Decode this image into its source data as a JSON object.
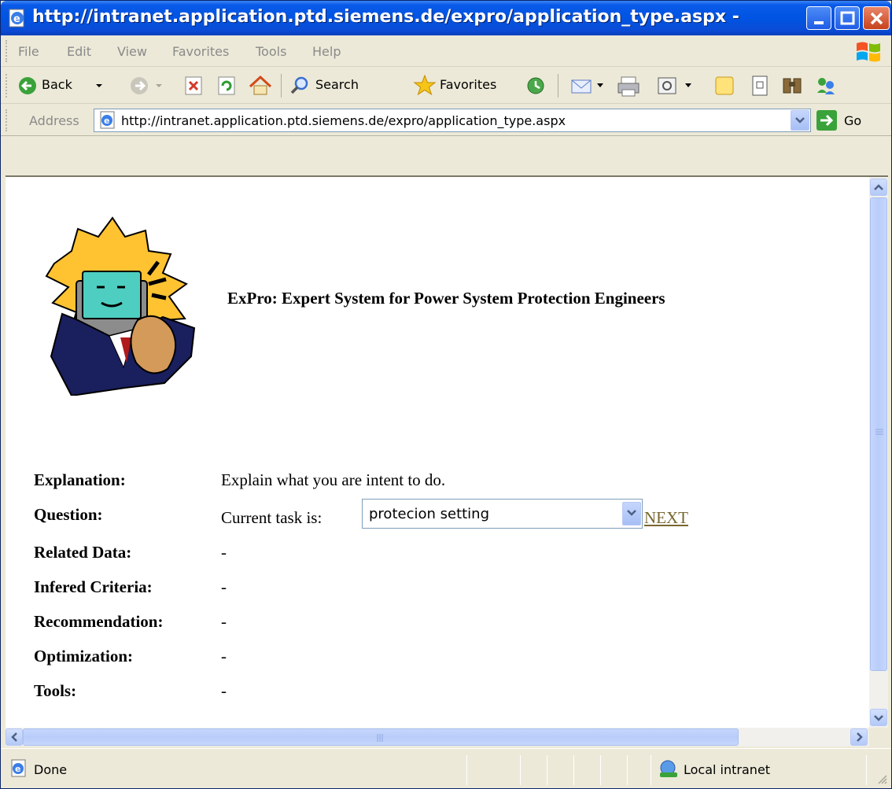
{
  "window": {
    "title": "http://intranet.application.ptd.siemens.de/expro/application_type.aspx - PT…"
  },
  "menu": {
    "items": [
      "File",
      "Edit",
      "View",
      "Favorites",
      "Tools",
      "Help"
    ]
  },
  "toolbar": {
    "back_label": "Back",
    "search_label": "Search",
    "favorites_label": "Favorites"
  },
  "address": {
    "label": "Address",
    "url": "http://intranet.application.ptd.siemens.de/expro/application_type.aspx",
    "go_label": "Go"
  },
  "page": {
    "title": "ExPro: Expert System for Power System Protection Engineers",
    "rows": [
      {
        "label": "Explanation:",
        "value": "Explain what you are intent to do."
      },
      {
        "label": "Question:",
        "value": "Current task is:"
      },
      {
        "label": "Related Data:",
        "value": "-"
      },
      {
        "label": "Infered Criteria:",
        "value": "-"
      },
      {
        "label": "Recommendation:",
        "value": "-"
      },
      {
        "label": "Optimization:",
        "value": "-"
      },
      {
        "label": "Tools:",
        "value": "-"
      }
    ],
    "task_select_value": "protecion setting",
    "next_link": "NEXT"
  },
  "status": {
    "text": "Done",
    "zone": "Local intranet"
  },
  "colors": {
    "titlebar": "#0054e3",
    "chrome": "#ece9d8",
    "link": "#79662d"
  }
}
